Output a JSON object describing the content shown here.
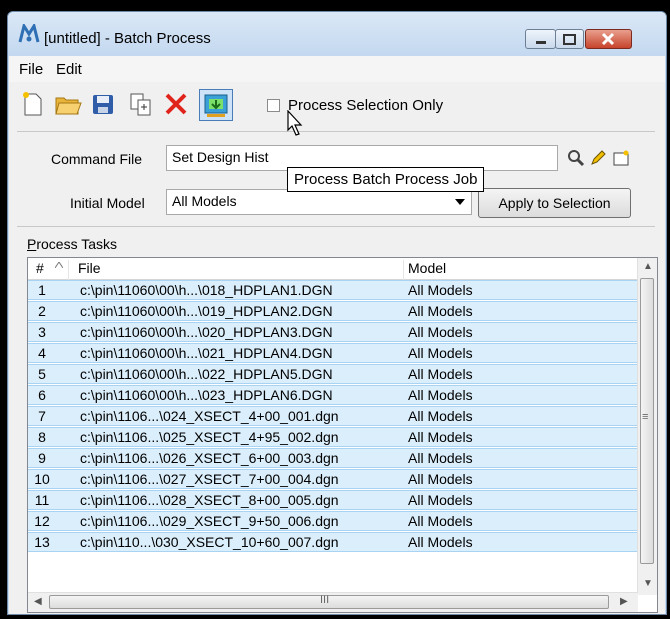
{
  "window": {
    "title": "[untitled] - Batch Process"
  },
  "menu": {
    "file": "File",
    "edit": "Edit"
  },
  "toolbar": {
    "new_icon": "new-document-icon",
    "open_icon": "open-folder-icon",
    "save_icon": "save-icon",
    "copy_icon": "copy-icon",
    "delete_icon": "delete-icon",
    "process_icon": "process-batch-icon",
    "process_selection_label": "Process Selection Only",
    "process_selection_checked": false
  },
  "tooltip": {
    "text": "Process Batch Process Job"
  },
  "command_file": {
    "label": "Command File",
    "value": "Set Design Hist"
  },
  "initial_model": {
    "label": "Initial Model",
    "value": "All Models"
  },
  "apply_button": {
    "label": "Apply to Selection"
  },
  "tasks": {
    "label_first": "P",
    "label_rest": "rocess Tasks",
    "columns": {
      "num": "#",
      "file": "File",
      "model": "Model"
    },
    "rows": [
      {
        "n": "1",
        "file": "c:\\pin\\11060\\00\\h...\\018_HDPLAN1.DGN",
        "model": "All Models"
      },
      {
        "n": "2",
        "file": "c:\\pin\\11060\\00\\h...\\019_HDPLAN2.DGN",
        "model": "All Models"
      },
      {
        "n": "3",
        "file": "c:\\pin\\11060\\00\\h...\\020_HDPLAN3.DGN",
        "model": "All Models"
      },
      {
        "n": "4",
        "file": "c:\\pin\\11060\\00\\h...\\021_HDPLAN4.DGN",
        "model": "All Models"
      },
      {
        "n": "5",
        "file": "c:\\pin\\11060\\00\\h...\\022_HDPLAN5.DGN",
        "model": "All Models"
      },
      {
        "n": "6",
        "file": "c:\\pin\\11060\\00\\h...\\023_HDPLAN6.DGN",
        "model": "All Models"
      },
      {
        "n": "7",
        "file": "c:\\pin\\1106...\\024_XSECT_4+00_001.dgn",
        "model": "All Models"
      },
      {
        "n": "8",
        "file": "c:\\pin\\1106...\\025_XSECT_4+95_002.dgn",
        "model": "All Models"
      },
      {
        "n": "9",
        "file": "c:\\pin\\1106...\\026_XSECT_6+00_003.dgn",
        "model": "All Models"
      },
      {
        "n": "10",
        "file": "c:\\pin\\1106...\\027_XSECT_7+00_004.dgn",
        "model": "All Models"
      },
      {
        "n": "11",
        "file": "c:\\pin\\1106...\\028_XSECT_8+00_005.dgn",
        "model": "All Models"
      },
      {
        "n": "12",
        "file": "c:\\pin\\1106...\\029_XSECT_9+50_006.dgn",
        "model": "All Models"
      },
      {
        "n": "13",
        "file": "c:\\pin\\110...\\030_XSECT_10+60_007.dgn",
        "model": "All Models"
      }
    ]
  },
  "scrollbar": {
    "h_glyph": "III",
    "v_glyph": "≡"
  },
  "colors": {
    "selected_row": "#dbeefb",
    "row_border": "#a8d3f2",
    "close_button": "#c7432b"
  }
}
